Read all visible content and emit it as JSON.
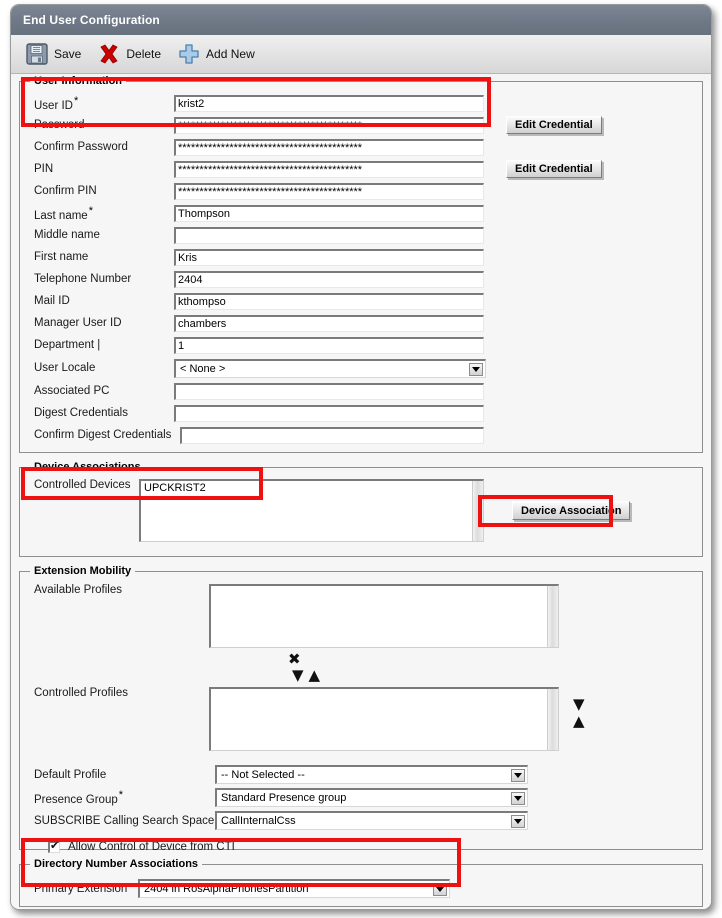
{
  "window": {
    "title": "End User Configuration"
  },
  "toolbar": {
    "items": [
      {
        "label": "Save",
        "icon": "save-floppy-icon"
      },
      {
        "label": "Delete",
        "icon": "delete-x-icon"
      },
      {
        "label": "Add New",
        "icon": "add-plus-icon"
      }
    ]
  },
  "user_information": {
    "legend": "User Information",
    "fields": {
      "user_id_label": "User ID",
      "user_id_value": "krist2",
      "password_label": "Password",
      "password_value": "*******************************************",
      "confirm_password_label": "Confirm Password",
      "confirm_password_value": "*******************************************",
      "pin_label": "PIN",
      "pin_value": "*******************************************",
      "confirm_pin_label": "Confirm PIN",
      "confirm_pin_value": "*******************************************",
      "last_name_label": "Last name",
      "last_name_value": "Thompson",
      "middle_name_label": "Middle name",
      "middle_name_value": "",
      "first_name_label": "First name",
      "first_name_value": "Kris",
      "telephone_label": "Telephone Number",
      "telephone_value": "2404",
      "mail_id_label": "Mail ID",
      "mail_id_value": "kthompso",
      "manager_label": "Manager User ID",
      "manager_value": "chambers",
      "department_label": "Department |",
      "department_value": "1",
      "user_locale_label": "User Locale",
      "user_locale_value": "< None >",
      "associated_pc_label": "Associated PC",
      "associated_pc_value": "",
      "digest_label": "Digest Credentials",
      "digest_value": "",
      "confirm_digest_label": "Confirm Digest Credentials",
      "confirm_digest_value": ""
    },
    "edit_credential_password_label": "Edit Credential",
    "edit_credential_pin_label": "Edit Credential"
  },
  "device_associations": {
    "legend": "Device Associations",
    "controlled_devices_label": "Controlled Devices",
    "controlled_devices_items": [
      "UPCKRIST2"
    ],
    "device_association_button": "Device Association"
  },
  "extension_mobility": {
    "legend": "Extension Mobility",
    "available_profiles_label": "Available Profiles",
    "available_profiles_items": [],
    "controlled_profiles_label": "Controlled Profiles",
    "controlled_profiles_items": [],
    "move_down_icon": "chevron-down-icon",
    "move_up_icon": "chevron-up-icon",
    "default_profile_label": "Default Profile",
    "default_profile_value": "-- Not Selected --",
    "presence_group_label": "Presence Group",
    "presence_group_value": "Standard Presence group",
    "subscribe_css_label": "SUBSCRIBE Calling Search Space",
    "subscribe_css_value": "CallInternalCss",
    "allow_cti_label": "Allow Control of Device from CTI",
    "allow_cti_checked": true
  },
  "directory_number_associations": {
    "legend": "Directory Number Associations",
    "primary_extension_label": "Primary Extension",
    "primary_extension_value": "2404 in RosAlphaPhonesPartition"
  },
  "annotations": {
    "highlight_color": "#ee1111",
    "boxes": [
      "user-id-password-highlight",
      "edit-credential-highlight",
      "controlled-devices-highlight",
      "device-association-highlight",
      "directory-number-associations-highlight"
    ]
  }
}
